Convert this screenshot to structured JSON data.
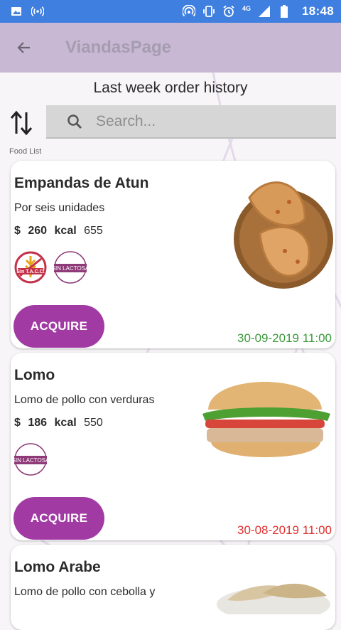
{
  "statusbar": {
    "time": "18:48",
    "network": "4G"
  },
  "appbar": {
    "title": "ViandasPage"
  },
  "subtitle": "Last week order history",
  "search": {
    "placeholder": "Search..."
  },
  "food_list_label": "Food List",
  "cards": [
    {
      "name": "Empandas de Atun",
      "description": "Por seis unidades",
      "currency": "$",
      "price": "260",
      "kcal_label": "kcal",
      "kcal": "655",
      "badges": [
        "Sin T.A.C.C.",
        "SIN LACTOSA"
      ],
      "button": "ACQUIRE",
      "date": "30-09-2019 11:00",
      "date_color": "#3a9a3a"
    },
    {
      "name": "Lomo",
      "description": "Lomo de pollo con verduras",
      "currency": "$",
      "price": "186",
      "kcal_label": "kcal",
      "kcal": "550",
      "badges": [
        "SIN LACTOSA"
      ],
      "button": "ACQUIRE",
      "date": "30-08-2019 11:00",
      "date_color": "#e03030"
    },
    {
      "name": "Lomo Arabe",
      "description": "Lomo de pollo con cebolla y"
    }
  ],
  "colors": {
    "statusbar": "#3f7fe0",
    "appbar": "#c8b8d4",
    "accent": "#a23aa4"
  }
}
